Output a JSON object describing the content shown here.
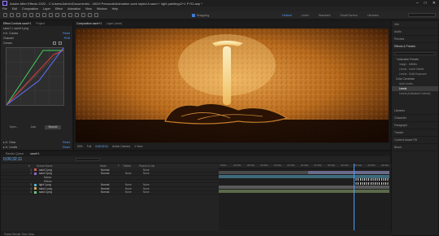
{
  "titlebar": {
    "title": "Adobe After Effects 2022 - C:\\Users\\Admin\\Documents\\...\\5519 Personal\\Animation work styled A sand + light painting\\2+1 P R2.aep *",
    "minimize": "–",
    "maximize": "□",
    "close": "✕"
  },
  "menu": [
    "File",
    "Edit",
    "Composition",
    "Layer",
    "Effect",
    "Animation",
    "View",
    "Window",
    "Help"
  ],
  "toolbar": {
    "snapping": "Snapping",
    "workspaces": [
      "Default",
      "Learn",
      "Standard",
      "Small Screen",
      "Libraries"
    ],
    "active_workspace": "Default"
  },
  "effects_panel": {
    "tabs": [
      "Effect Controls sand+1",
      "Project"
    ],
    "layer_line": "sand 1 • sand+1.png",
    "effects": [
      {
        "name": "Curves",
        "link": "Reset"
      },
      {
        "name": "Channel",
        "link": "RGB"
      },
      {
        "name": "Curves",
        "link": ""
      }
    ],
    "curve_buttons": [
      "Open...",
      "Auto",
      "Smooth",
      "Save..."
    ],
    "selected_curve_button": "Smooth",
    "bottom_effects": [
      {
        "name": "Glow",
        "link": "Reset"
      },
      {
        "name": "Levels",
        "link": "Reset"
      }
    ]
  },
  "comp_panel": {
    "tabs": [
      "Composition sand+1",
      "Layer (none)"
    ],
    "breadcrumb": "sand+1",
    "footer": {
      "zoom": "50%",
      "quality": "Full",
      "timecode": "0;00;32;11",
      "camera": "Active Camera",
      "views": "1 View"
    }
  },
  "right_panel": {
    "items": [
      "Info",
      "Audio",
      "Preview",
      "Effects & Presets",
      "Libraries",
      "Character",
      "Paragraph",
      "Tracker",
      "Content-Aware Fill",
      "Brush"
    ],
    "search_placeholder": "",
    "tree": [
      {
        "label": "* Animation Presets",
        "level": 0,
        "selected": false
      },
      {
        "label": "Image - Utilities",
        "level": 1,
        "selected": false
      },
      {
        "label": "Levels - Invert Visible",
        "level": 1,
        "selected": false
      },
      {
        "label": "Levels - Solid Exposure",
        "level": 1,
        "selected": false
      },
      {
        "label": "Color Correction",
        "level": 0,
        "selected": false
      },
      {
        "label": "Auto Levels",
        "level": 1,
        "selected": false
      },
      {
        "label": "Levels",
        "level": 1,
        "selected": true
      },
      {
        "label": "Levels (Individual Controls)",
        "level": 1,
        "selected": false
      }
    ]
  },
  "timeline": {
    "tabs": [
      "Render Queue",
      "sand+1"
    ],
    "timecode": "0;00;32;11",
    "columns": [
      "#",
      "Source Name",
      "Mode",
      "T",
      "TrkMat",
      "Parent & Link"
    ],
    "rows": [
      {
        "num": "1",
        "name": "sand 2.png",
        "mode": "Normal",
        "trk": "",
        "parent": "None",
        "color": "#c75a5a",
        "sub": false
      },
      {
        "num": "2",
        "name": "sand 3.png",
        "mode": "Normal",
        "trk": "None",
        "parent": "None",
        "color": "#8a6ac7",
        "sub": false
      },
      {
        "num": "",
        "name": "Masks",
        "mode": "",
        "trk": "",
        "parent": "",
        "color": "transparent",
        "sub": true
      },
      {
        "num": "",
        "name": "Effects",
        "mode": "",
        "trk": "",
        "parent": "",
        "color": "transparent",
        "sub": true
      },
      {
        "num": "3",
        "name": "light 1.png",
        "mode": "Normal",
        "trk": "None",
        "parent": "None",
        "color": "#5ab0c7",
        "sub": false
      },
      {
        "num": "4",
        "name": "sand 1.png",
        "mode": "Normal",
        "trk": "None",
        "parent": "None",
        "color": "#c7a85a",
        "sub": false
      },
      {
        "num": "5",
        "name": "sand 4.png",
        "mode": "Normal",
        "trk": "None",
        "parent": "None",
        "color": "#6ac77a",
        "sub": false
      }
    ],
    "ruler_ticks": [
      "0:00s",
      "00:15s",
      "00:30s",
      "00:45s",
      "01:00s",
      "01:15s",
      "01:30s",
      "01:45s",
      "02:00s",
      "02:15s",
      "02:30s",
      "02:45s",
      "03:00s"
    ],
    "footer": "Frame Render Time  13ms"
  },
  "colors": {
    "accent": "#4e9bff",
    "timecode": "#6fb6ff",
    "curve_red": "#e04040",
    "curve_green": "#40d060",
    "curve_blue": "#4060ff"
  }
}
